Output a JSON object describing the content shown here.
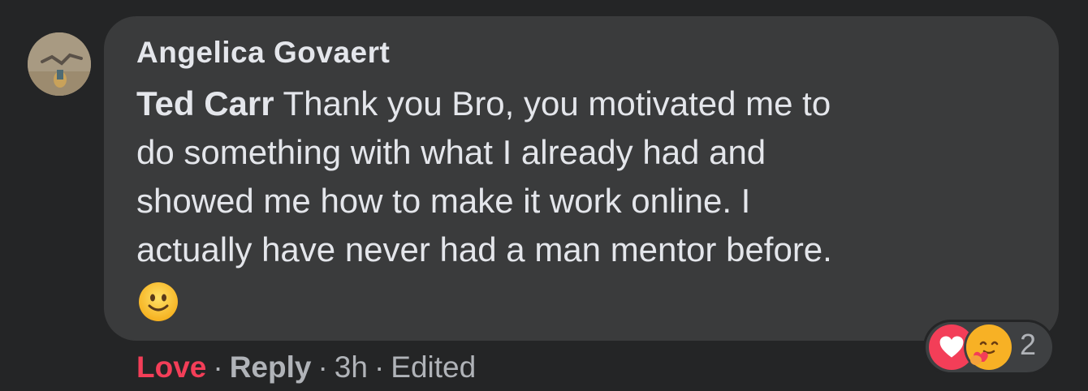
{
  "comment": {
    "author": "Angelica Govaert",
    "mention": "Ted Carr",
    "text_lines": [
      " Thank you Bro, you motivated me to",
      "do something with what I already had and",
      "showed me how to make it work online. I",
      "actually have never had a man mentor before."
    ],
    "emoji": "slightly-smiling-face"
  },
  "reactions": {
    "types": [
      "love",
      "care"
    ],
    "count": "2",
    "colors": {
      "love": "#f33e58",
      "care": "#f7b125"
    }
  },
  "actions": {
    "love_label": "Love",
    "separator": "·",
    "reply_label": "Reply",
    "time": "3h",
    "edited": "Edited"
  },
  "colors": {
    "background": "#242526",
    "bubble": "#3a3b3c",
    "text": "#e4e6eb",
    "secondary_text": "#b0b3b8"
  }
}
